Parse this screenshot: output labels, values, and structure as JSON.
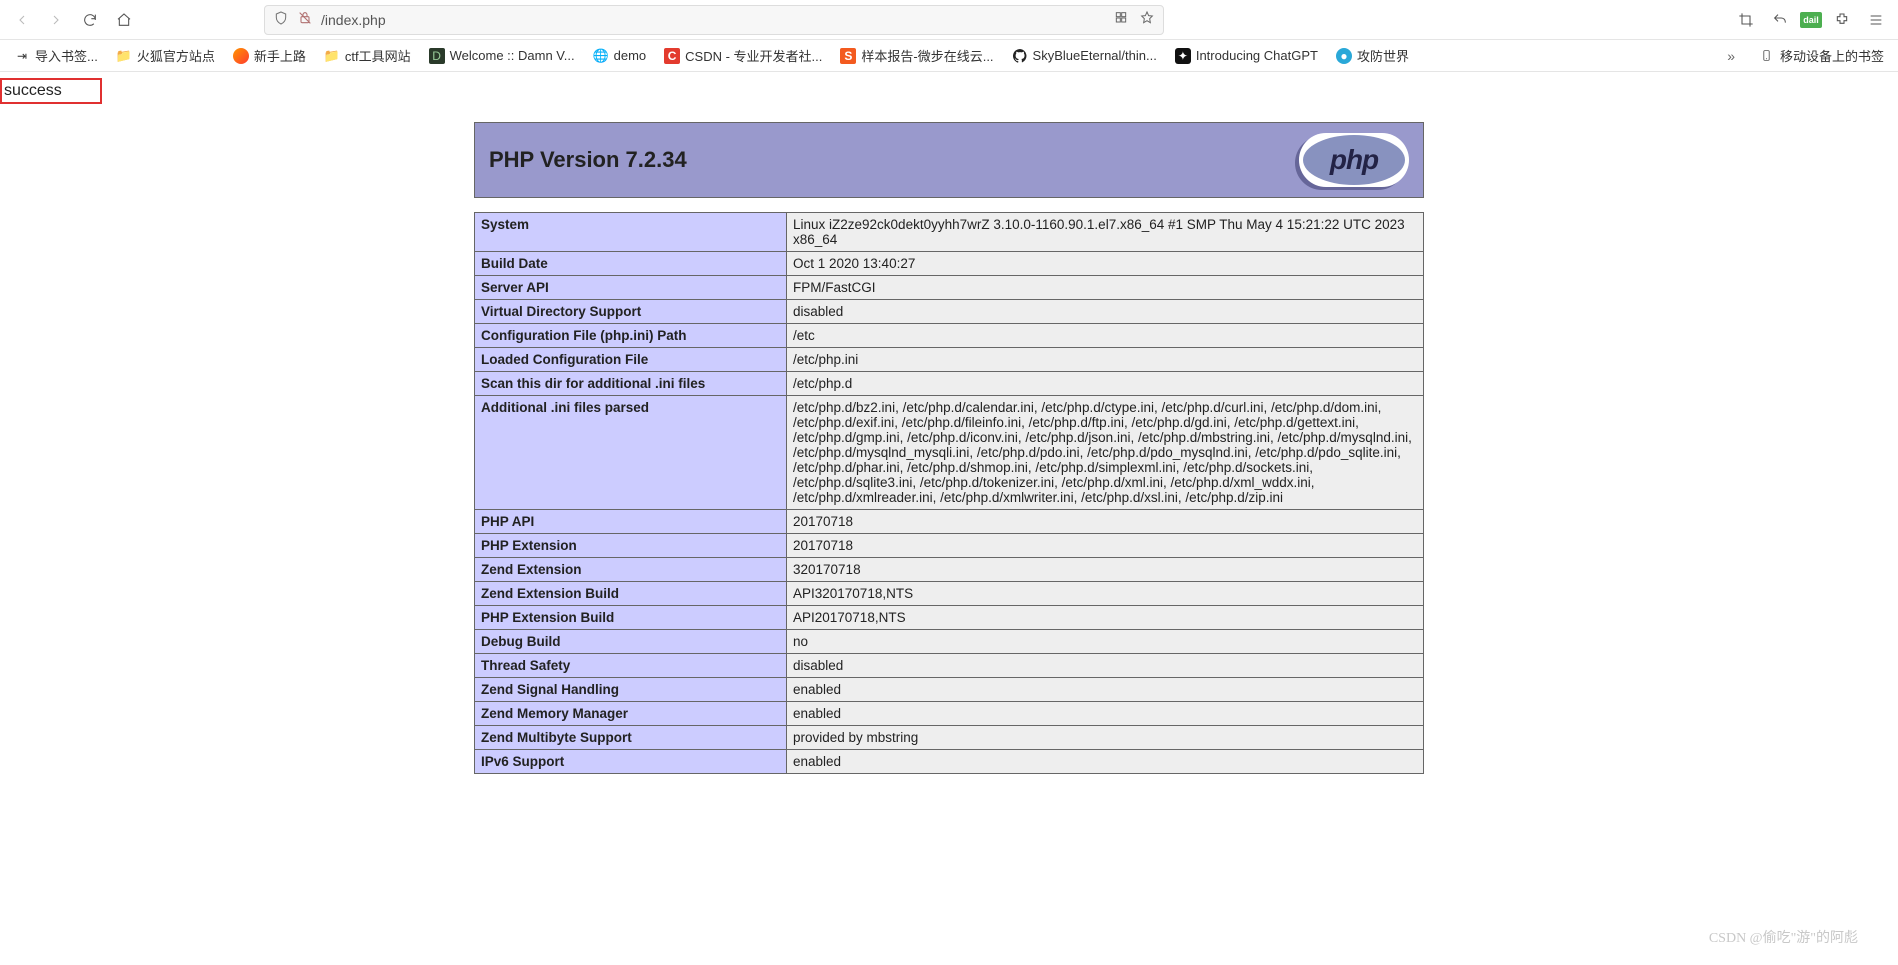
{
  "nav": {
    "url_visible": "/index.php"
  },
  "bookmarks": [
    {
      "label": "导入书签...",
      "icon": "import"
    },
    {
      "label": "火狐官方站点",
      "icon": "folder"
    },
    {
      "label": "新手上路",
      "icon": "firefox"
    },
    {
      "label": "ctf工具网站",
      "icon": "folder"
    },
    {
      "label": "Welcome :: Damn V...",
      "icon": "dvwa"
    },
    {
      "label": "demo",
      "icon": "globe"
    },
    {
      "label": "CSDN - 专业开发者社...",
      "icon": "csdn"
    },
    {
      "label": "样本报告-微步在线云...",
      "icon": "threatbook"
    },
    {
      "label": "SkyBlueEternal/thin...",
      "icon": "github"
    },
    {
      "label": "Introducing ChatGPT",
      "icon": "openai"
    },
    {
      "label": "攻防世界",
      "icon": "adworld"
    }
  ],
  "bookmarks_right": {
    "label": "移动设备上的书签"
  },
  "page_text": {
    "success": "success"
  },
  "php": {
    "title": "PHP Version 7.2.34",
    "rows": [
      {
        "k": "System",
        "v": "Linux iZ2ze92ck0dekt0yyhh7wrZ 3.10.0-1160.90.1.el7.x86_64 #1 SMP Thu May 4 15:21:22 UTC 2023 x86_64"
      },
      {
        "k": "Build Date",
        "v": "Oct 1 2020 13:40:27"
      },
      {
        "k": "Server API",
        "v": "FPM/FastCGI"
      },
      {
        "k": "Virtual Directory Support",
        "v": "disabled"
      },
      {
        "k": "Configuration File (php.ini) Path",
        "v": "/etc"
      },
      {
        "k": "Loaded Configuration File",
        "v": "/etc/php.ini"
      },
      {
        "k": "Scan this dir for additional .ini files",
        "v": "/etc/php.d"
      },
      {
        "k": "Additional .ini files parsed",
        "v": "/etc/php.d/bz2.ini, /etc/php.d/calendar.ini, /etc/php.d/ctype.ini, /etc/php.d/curl.ini, /etc/php.d/dom.ini, /etc/php.d/exif.ini, /etc/php.d/fileinfo.ini, /etc/php.d/ftp.ini, /etc/php.d/gd.ini, /etc/php.d/gettext.ini, /etc/php.d/gmp.ini, /etc/php.d/iconv.ini, /etc/php.d/json.ini, /etc/php.d/mbstring.ini, /etc/php.d/mysqlnd.ini, /etc/php.d/mysqlnd_mysqli.ini, /etc/php.d/pdo.ini, /etc/php.d/pdo_mysqlnd.ini, /etc/php.d/pdo_sqlite.ini, /etc/php.d/phar.ini, /etc/php.d/shmop.ini, /etc/php.d/simplexml.ini, /etc/php.d/sockets.ini, /etc/php.d/sqlite3.ini, /etc/php.d/tokenizer.ini, /etc/php.d/xml.ini, /etc/php.d/xml_wddx.ini, /etc/php.d/xmlreader.ini, /etc/php.d/xmlwriter.ini, /etc/php.d/xsl.ini, /etc/php.d/zip.ini"
      },
      {
        "k": "PHP API",
        "v": "20170718"
      },
      {
        "k": "PHP Extension",
        "v": "20170718"
      },
      {
        "k": "Zend Extension",
        "v": "320170718"
      },
      {
        "k": "Zend Extension Build",
        "v": "API320170718,NTS"
      },
      {
        "k": "PHP Extension Build",
        "v": "API20170718,NTS"
      },
      {
        "k": "Debug Build",
        "v": "no"
      },
      {
        "k": "Thread Safety",
        "v": "disabled"
      },
      {
        "k": "Zend Signal Handling",
        "v": "enabled"
      },
      {
        "k": "Zend Memory Manager",
        "v": "enabled"
      },
      {
        "k": "Zend Multibyte Support",
        "v": "provided by mbstring"
      },
      {
        "k": "IPv6 Support",
        "v": "enabled"
      }
    ]
  },
  "watermark": "CSDN @偷吃\"游\"的阿彪",
  "logo_text": "php",
  "dail_text": "dail"
}
